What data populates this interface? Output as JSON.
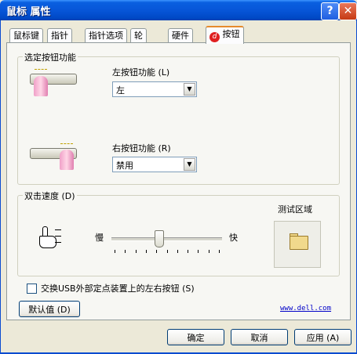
{
  "window": {
    "title": "鼠标 属性"
  },
  "tabs": [
    {
      "label": "鼠标键"
    },
    {
      "label": "指针"
    },
    {
      "label": "指针选项"
    },
    {
      "label": "轮"
    },
    {
      "label": "硬件"
    },
    {
      "label": "按钮"
    }
  ],
  "button_function": {
    "group_title": "选定按钮功能",
    "left_label": "左按钮功能 (L)",
    "left_value": "左",
    "right_label": "右按钮功能 (R)",
    "right_value": "禁用"
  },
  "double_click": {
    "group_title": "双击速度 (D)",
    "slow_label": "慢",
    "fast_label": "快",
    "test_area_label": "测试区域",
    "speed_fraction": 0.42
  },
  "swap": {
    "label": "交换USB外部定点装置上的左右按钮 (S)",
    "checked": false
  },
  "defaults_button": "默认值 (D)",
  "link": "www.dell.com",
  "footer": {
    "ok": "确定",
    "cancel": "取消",
    "apply": "应用 (A)"
  },
  "icons": [
    "help-icon",
    "close-icon",
    "dell-icon",
    "mouse-left-click-icon",
    "mouse-right-click-icon",
    "hand-pointer-icon",
    "folder-icon"
  ]
}
